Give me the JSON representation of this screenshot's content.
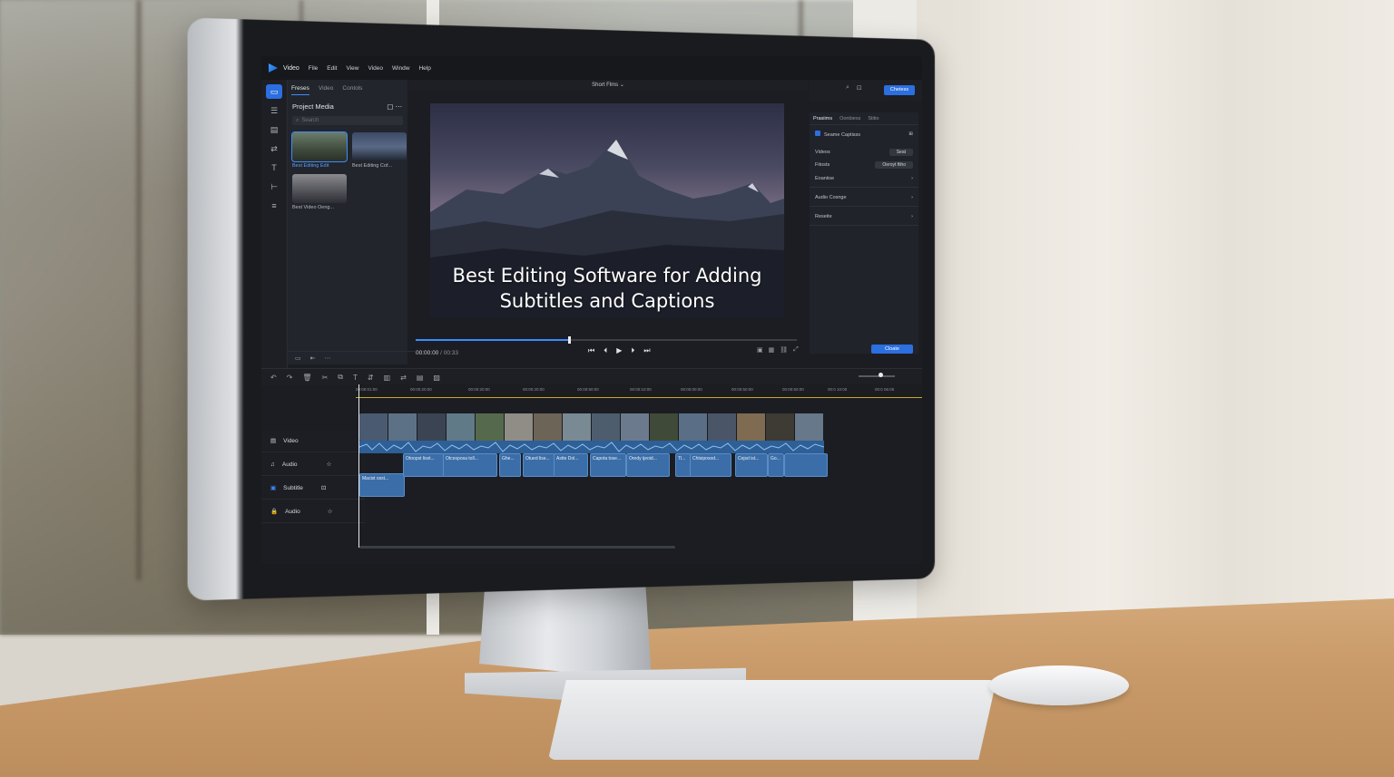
{
  "app": {
    "name": "Video",
    "menu": [
      "File",
      "Edit",
      "View",
      "Video",
      "Windw",
      "Help"
    ]
  },
  "left_rail": {
    "icons": [
      "media-icon",
      "effects-icon",
      "titles-icon",
      "transitions-icon",
      "text-icon",
      "crop-icon",
      "adjust-icon"
    ]
  },
  "media_panel": {
    "tabs": [
      "Freses",
      "Video",
      "Contols"
    ],
    "title": "Project Media",
    "search_placeholder": "Search",
    "items": [
      {
        "label": "Best Editing Edit",
        "selected": true
      },
      {
        "label": "Best Editing Cof...",
        "selected": false
      },
      {
        "label": "Best Video Oeng...",
        "selected": false
      }
    ]
  },
  "preview": {
    "sequence_name": "Short Flms",
    "caption_line1": "Best Editing Software for Adding",
    "caption_line2": "Subtitles and Captions",
    "timecode": "00:00:00",
    "duration": "/ 00:33",
    "progress": 0.4
  },
  "header": {
    "export_label": "Chetess"
  },
  "inspector": {
    "tabs": [
      "Prasiims",
      "Oonbiess",
      "Stitio"
    ],
    "checkbox_label": "Seame Captisss",
    "rows": [
      {
        "label": "Videos",
        "value": "Seat"
      },
      {
        "label": "Fitosts",
        "value": "Oeroyt fiiho"
      }
    ],
    "sections": [
      "Eoaniise",
      "Audio Cosnge",
      "Reseite"
    ],
    "create_label": "Cloate"
  },
  "timeline": {
    "ruler_ticks": [
      "00:00:01:00",
      "00:00:20:00",
      "00:00:20:00",
      "00:00:20:00",
      "00:00:50:00",
      "00:00:10:00",
      "00:00:00:00",
      "00:00:50:00",
      "00:00:50:00",
      "00:0 10:00",
      "00:0 06:05"
    ],
    "tracks": [
      {
        "name": "Video",
        "icon": "film-icon"
      },
      {
        "name": "Audio",
        "icon": "music-icon"
      },
      {
        "name": "Subtitle",
        "icon": "subtitle-icon"
      },
      {
        "name": "Audio",
        "icon": "lock-icon"
      }
    ],
    "subtitle_clips": [
      "Macist osst...",
      "Otoopst lisst...",
      "Otcesposa toll...",
      "Ghe...",
      "Otued lise...",
      "Astte Dol...",
      "Capota tose...",
      "Oredy ijeoid...",
      "Tl...",
      "Chtsiposod...",
      "Cejsd ist...",
      "Go..."
    ]
  },
  "colors": {
    "accent": "#2b6fe0",
    "app_bg": "#1b1d22",
    "clip_blue": "#3b6ea8"
  }
}
